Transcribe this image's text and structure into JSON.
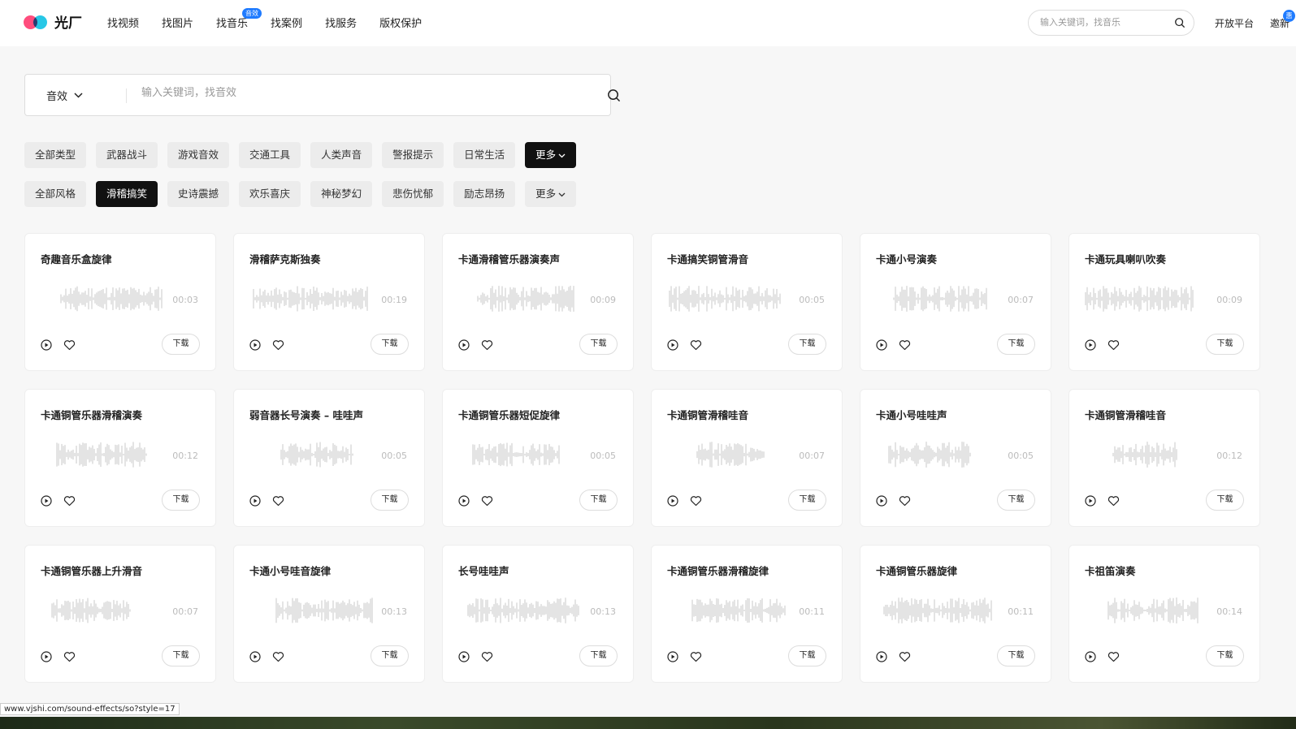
{
  "header": {
    "logo_text": "光厂",
    "nav": [
      "找视频",
      "找图片",
      "找音乐",
      "找案例",
      "找服务",
      "版权保护"
    ],
    "music_badge": "音效",
    "search_placeholder": "输入关键词，找音乐",
    "open_platform": "开放平台",
    "invite": "邀新",
    "invite_badge": "惠"
  },
  "search": {
    "type": "音效",
    "placeholder": "输入关键词，找音效"
  },
  "filters": {
    "types": [
      "全部类型",
      "武器战斗",
      "游戏音效",
      "交通工具",
      "人类声音",
      "警报提示",
      "日常生活",
      "更多"
    ],
    "types_active": 7,
    "styles": [
      "全部风格",
      "滑稽搞笑",
      "史诗震撼",
      "欢乐喜庆",
      "神秘梦幻",
      "悲伤忧郁",
      "励志昂扬",
      "更多"
    ],
    "styles_active": 1
  },
  "download_label": "下载",
  "cards": [
    {
      "title": "奇趣音乐盒旋律",
      "duration": "00:03"
    },
    {
      "title": "滑稽萨克斯独奏",
      "duration": "00:19"
    },
    {
      "title": "卡通滑稽管乐器演奏声",
      "duration": "00:09"
    },
    {
      "title": "卡通搞笑铜管滑音",
      "duration": "00:05"
    },
    {
      "title": "卡通小号演奏",
      "duration": "00:07"
    },
    {
      "title": "卡通玩具喇叭吹奏",
      "duration": "00:09"
    },
    {
      "title": "卡通铜管乐器滑稽演奏",
      "duration": "00:12"
    },
    {
      "title": "弱音器长号演奏 – 哇哇声",
      "duration": "00:05"
    },
    {
      "title": "卡通铜管乐器短促旋律",
      "duration": "00:05"
    },
    {
      "title": "卡通铜管滑稽哇音",
      "duration": "00:07"
    },
    {
      "title": "卡通小号哇哇声",
      "duration": "00:05"
    },
    {
      "title": "卡通铜管滑稽哇音",
      "duration": "00:12"
    },
    {
      "title": "卡通铜管乐器上升滑音",
      "duration": "00:07"
    },
    {
      "title": "卡通小号哇音旋律",
      "duration": "00:13"
    },
    {
      "title": "长号哇哇声",
      "duration": "00:13"
    },
    {
      "title": "卡通铜管乐器滑稽旋律",
      "duration": "00:11"
    },
    {
      "title": "卡通铜管乐器旋律",
      "duration": "00:11"
    },
    {
      "title": "卡祖笛演奏",
      "duration": "00:14"
    }
  ],
  "status_url": "www.vjshi.com/sound-effects/so?style=17"
}
